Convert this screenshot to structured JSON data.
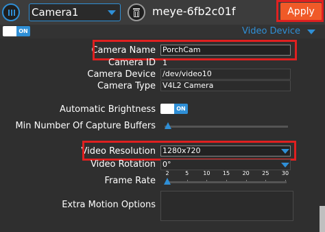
{
  "header": {
    "camera_select_value": "Camera1",
    "device_id": "meye-6fb2c01f",
    "apply_label": "Apply"
  },
  "section": {
    "title": "Video Device",
    "toggle_label": "ON"
  },
  "fields": {
    "camera_name": {
      "label": "Camera Name",
      "value": "PorchCam"
    },
    "camera_id": {
      "label": "Camera ID",
      "value": "1"
    },
    "camera_device": {
      "label": "Camera Device",
      "value": "/dev/video10"
    },
    "camera_type": {
      "label": "Camera Type",
      "value": "V4L2 Camera"
    },
    "auto_brightness": {
      "label": "Automatic Brightness",
      "toggle_label": "ON"
    },
    "min_buffers": {
      "label": "Min Number Of Capture Buffers",
      "level": 0
    },
    "video_resolution": {
      "label": "Video Resolution",
      "value": "1280x720"
    },
    "video_rotation": {
      "label": "Video Rotation",
      "value": "0°"
    },
    "frame_rate": {
      "label": "Frame Rate",
      "value": 2,
      "ticks": [
        "2",
        "5",
        "10",
        "15",
        "20",
        "25",
        "30"
      ]
    },
    "extra_motion": {
      "label": "Extra Motion Options",
      "value": ""
    }
  },
  "colors": {
    "accent": "#2f8fd6",
    "apply": "#f05a28",
    "highlight": "#e02020",
    "background": "#2f2f2f"
  },
  "icons": {
    "menu": "menu-icon",
    "delete": "trash-icon",
    "dropdown": "chevron-down-icon"
  }
}
